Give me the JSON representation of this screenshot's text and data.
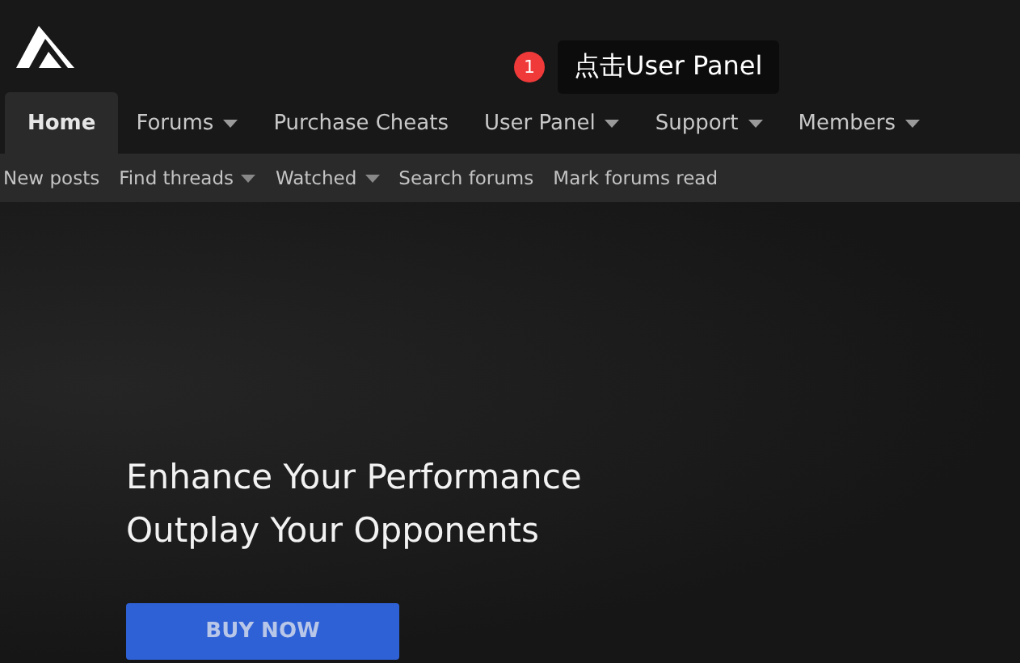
{
  "header": {
    "callout": {
      "step": "1",
      "text": "点击User Panel"
    }
  },
  "nav": [
    {
      "label": "Home",
      "selected": true,
      "has_menu": false
    },
    {
      "label": "Forums",
      "selected": false,
      "has_menu": true
    },
    {
      "label": "Purchase Cheats",
      "selected": false,
      "has_menu": false
    },
    {
      "label": "User Panel",
      "selected": false,
      "has_menu": true
    },
    {
      "label": "Support",
      "selected": false,
      "has_menu": true
    },
    {
      "label": "Members",
      "selected": false,
      "has_menu": true
    }
  ],
  "subnav": [
    {
      "label": "New posts",
      "has_menu": false
    },
    {
      "label": "Find threads",
      "has_menu": true
    },
    {
      "label": "Watched",
      "has_menu": true
    },
    {
      "label": "Search forums",
      "has_menu": false
    },
    {
      "label": "Mark forums read",
      "has_menu": false
    }
  ],
  "hero": {
    "lines": [
      "Enhance Your Performance",
      "Outplay Your Opponents"
    ],
    "button": "BUY NOW"
  }
}
